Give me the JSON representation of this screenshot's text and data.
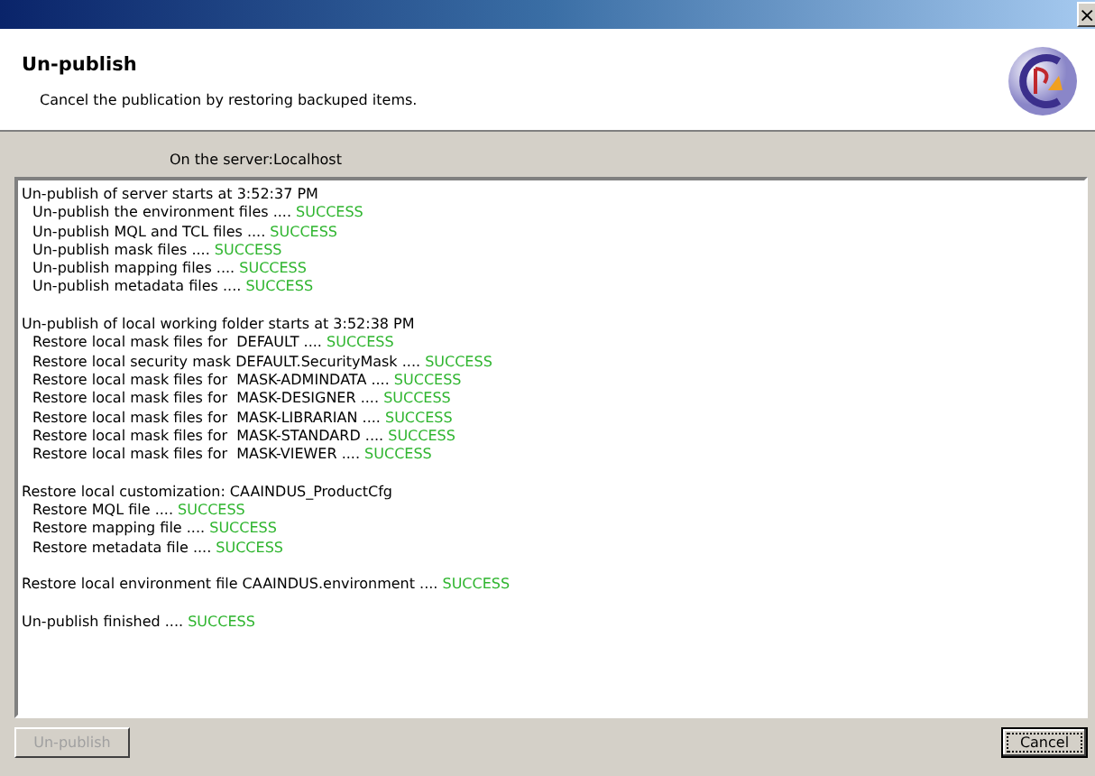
{
  "window": {
    "close": "×"
  },
  "header": {
    "title": "Un-publish",
    "subtitle": "Cancel the publication by restoring backuped items."
  },
  "server_label": "On the server:Localhost",
  "log": [
    {
      "lines": [
        {
          "text": "Un-publish of server starts at 3:52:37 PM",
          "indented": false
        },
        {
          "text": "Un-publish the environment files ....",
          "status": "SUCCESS",
          "indented": true
        },
        {
          "text": "Un-publish MQL and TCL files ....",
          "status": "SUCCESS",
          "indented": true
        },
        {
          "text": "Un-publish mask files ....",
          "status": "SUCCESS",
          "indented": true
        },
        {
          "text": "Un-publish mapping files ....",
          "status": "SUCCESS",
          "indented": true
        },
        {
          "text": "Un-publish metadata files ....",
          "status": "SUCCESS",
          "indented": true
        }
      ]
    },
    {
      "lines": [
        {
          "text": "Un-publish of local working folder starts at 3:52:38 PM",
          "indented": false
        },
        {
          "text": "Restore local mask files for  DEFAULT ....",
          "status": "SUCCESS",
          "indented": true
        },
        {
          "text": "Restore local security mask DEFAULT.SecurityMask ....",
          "status": "SUCCESS",
          "indented": true
        },
        {
          "text": "Restore local mask files for  MASK-ADMINDATA ....",
          "status": "SUCCESS",
          "indented": true
        },
        {
          "text": "Restore local mask files for  MASK-DESIGNER ....",
          "status": "SUCCESS",
          "indented": true
        },
        {
          "text": "Restore local mask files for  MASK-LIBRARIAN ....",
          "status": "SUCCESS",
          "indented": true
        },
        {
          "text": "Restore local mask files for  MASK-STANDARD ....",
          "status": "SUCCESS",
          "indented": true
        },
        {
          "text": "Restore local mask files for  MASK-VIEWER ....",
          "status": "SUCCESS",
          "indented": true
        }
      ]
    },
    {
      "lines": [
        {
          "text": "Restore local customization: CAAINDUS_ProductCfg",
          "indented": false
        },
        {
          "text": "Restore MQL file ....",
          "status": "SUCCESS",
          "indented": true
        },
        {
          "text": "Restore mapping file ....",
          "status": "SUCCESS",
          "indented": true
        },
        {
          "text": "Restore metadata file ....",
          "status": "SUCCESS",
          "indented": true
        }
      ]
    },
    {
      "lines": [
        {
          "text": "Restore local environment file CAAINDUS.environment ....",
          "status": "SUCCESS",
          "indented": false
        }
      ]
    },
    {
      "lines": [
        {
          "text": "Un-publish finished ....",
          "status": "SUCCESS",
          "indented": false
        }
      ]
    }
  ],
  "buttons": [
    {
      "label": "Un-publish",
      "disabled": true,
      "focused": false
    },
    {
      "label": "Cancel",
      "disabled": false,
      "focused": true
    }
  ]
}
